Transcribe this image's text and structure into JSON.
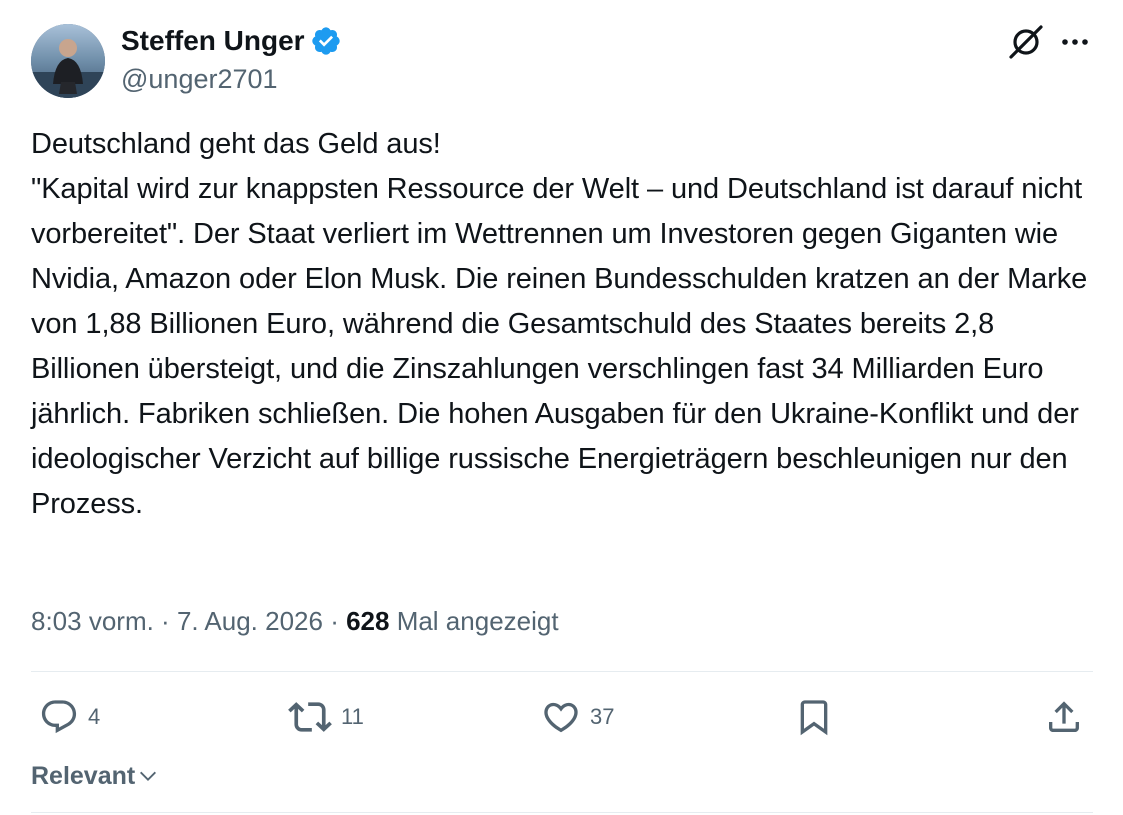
{
  "author": {
    "name": "Steffen Unger",
    "handle": "@unger2701",
    "verified": true
  },
  "tweet": {
    "text": "Deutschland geht das Geld aus!\n\"Kapital wird zur knappsten Ressource der Welt – und Deutschland ist darauf nicht vorbereitet\". Der Staat verliert im Wettrennen um Investoren gegen Giganten wie Nvidia, Amazon oder Elon Musk. Die reinen Bundesschulden kratzen an der Marke von 1,88 Billionen Euro, während die Gesamtschuld des Staates bereits 2,8 Billionen übersteigt, und die Zinszahlungen verschlingen fast 34 Milliarden Euro jährlich. Fabriken schließen. Die hohen Ausgaben für den Ukraine-Konflikt und der ideologischer Verzicht auf billige russische Energieträgern beschleunigen nur den Prozess.",
    "time": "8:03 vorm.",
    "separator": " · ",
    "date": "7. Aug. 2026",
    "views_count": "628",
    "views_label": " Mal angezeigt"
  },
  "actions": {
    "replies": "4",
    "reposts": "11",
    "likes": "37"
  },
  "sort": {
    "label": "Relevant"
  },
  "icons": {
    "verified": "verified-badge-icon",
    "grok": "grok-icon",
    "more": "more-icon",
    "reply": "reply-icon",
    "repost": "repost-icon",
    "like": "heart-icon",
    "bookmark": "bookmark-icon",
    "share": "share-icon",
    "chevron": "chevron-down-icon"
  },
  "colors": {
    "text": "#0f1419",
    "secondary": "#536471",
    "verified": "#1d9bf0",
    "divider": "#e6ecf0"
  }
}
